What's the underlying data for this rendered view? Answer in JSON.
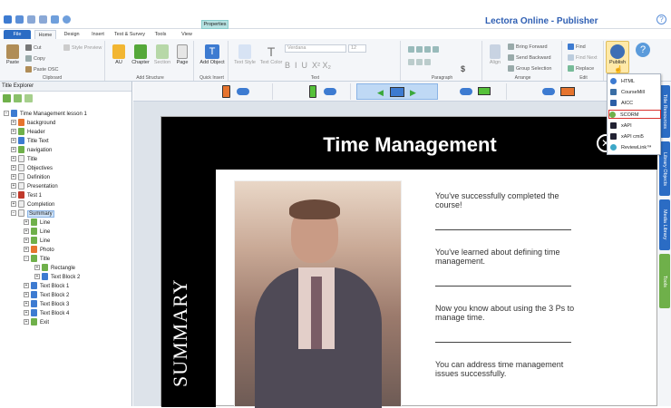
{
  "app": {
    "title": "Lectora Online - Publisher",
    "help_icon": "question-circle-icon"
  },
  "context_tab": {
    "group": "",
    "label": "Properties"
  },
  "tabs": [
    {
      "label": "File"
    },
    {
      "label": "Home"
    },
    {
      "label": "Design"
    },
    {
      "label": "Insert"
    },
    {
      "label": "Test & Survey"
    },
    {
      "label": "Tools"
    },
    {
      "label": "View"
    }
  ],
  "ribbon": {
    "clipboard": {
      "group": "Clipboard",
      "paste": "Paste",
      "cut": "Cut",
      "copy": "Copy",
      "paste_osc": "Paste OSC",
      "style_preview": "Style Preview"
    },
    "structure": {
      "group": "Add Structure",
      "au": "AU",
      "chapter": "Chapter",
      "section": "Section",
      "page": "Page"
    },
    "quick_insert": {
      "group": "Quick Insert",
      "add_object": "Add Object"
    },
    "text": {
      "group": "Text",
      "text_style": "Text Style",
      "text_color": "Text Color",
      "font": "Verdana",
      "size": "12"
    },
    "paragraph": {
      "group": "Paragraph"
    },
    "arrange": {
      "group": "Arrange",
      "align": "Align",
      "bring_forward": "Bring Forward",
      "send_backward": "Send Backward",
      "group_selection": "Group Selection"
    },
    "edit": {
      "group": "Edit",
      "find": "Find",
      "find_next": "Find Next",
      "replace": "Replace"
    },
    "publish": {
      "label": "Publish"
    }
  },
  "title_explorer": {
    "heading": "Title Explorer",
    "nodes": [
      {
        "label": "Time Management lesson 1"
      },
      {
        "label": "background"
      },
      {
        "label": "Header"
      },
      {
        "label": "Title Text"
      },
      {
        "label": "navigation"
      },
      {
        "label": "Title"
      },
      {
        "label": "Objectives"
      },
      {
        "label": "Definition"
      },
      {
        "label": "Presentation"
      },
      {
        "label": "Test 1"
      },
      {
        "label": "Completion"
      },
      {
        "label": "Summary"
      },
      {
        "label": "Line"
      },
      {
        "label": "Line"
      },
      {
        "label": "Line"
      },
      {
        "label": "Photo"
      },
      {
        "label": "Title"
      },
      {
        "label": "Rectangle"
      },
      {
        "label": "Text Block 2"
      },
      {
        "label": "Text Block 1"
      },
      {
        "label": "Text Block 2"
      },
      {
        "label": "Text Block 3"
      },
      {
        "label": "Text Block 4"
      },
      {
        "label": "Exit"
      }
    ]
  },
  "slide": {
    "title": "Time Management",
    "side_label": "SUMMARY",
    "close": "✕",
    "points": [
      "You've successfully completed the course!",
      "You've learned about defining time management.",
      "Now you know about using the 3 Ps to manage time.",
      "You can address time management issues successfully."
    ]
  },
  "publish_menu": [
    {
      "label": "HTML"
    },
    {
      "label": "CourseMill"
    },
    {
      "label": "AICC"
    },
    {
      "label": "SCORM",
      "highlighted": true
    },
    {
      "label": "xAPI"
    },
    {
      "label": "xAPI cmi5"
    },
    {
      "label": "ReviewLink™"
    }
  ],
  "right_tabs": [
    {
      "label": "Title Resources"
    },
    {
      "label": "Library Objects"
    },
    {
      "label": "Media Library"
    },
    {
      "label": "Tools"
    }
  ],
  "colors": {
    "accent": "#2b6cc4",
    "highlight": "#d9302c",
    "green": "#6fb04a"
  }
}
